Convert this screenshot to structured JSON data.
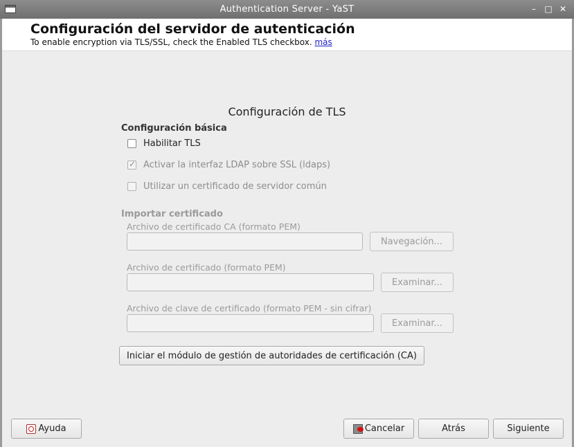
{
  "window": {
    "title": "Authentication Server - YaST",
    "controls": {
      "minimize": "–",
      "maximize": "□",
      "close": "✕"
    }
  },
  "header": {
    "title": "Configuración del servidor de autenticación",
    "help_text": "To enable encryption via TLS/SSL, check the Enabled TLS checkbox.",
    "help_link": "más"
  },
  "main": {
    "section_title": "Configuración de TLS",
    "basic": {
      "group_label": "Configuración básica",
      "checkboxes": [
        {
          "label": "Habilitar TLS",
          "checked": false,
          "enabled": true
        },
        {
          "label": "Activar la interfaz LDAP sobre SSL (ldaps)",
          "checked": true,
          "enabled": false
        },
        {
          "label": "Utilizar un certificado de servidor común",
          "checked": false,
          "enabled": false
        }
      ]
    },
    "import": {
      "group_label": "Importar certificado",
      "fields": [
        {
          "label": "Archivo de certificado CA (formato PEM)",
          "value": "",
          "button": "Navegación..."
        },
        {
          "label": "Archivo de certificado (formato PEM)",
          "value": "",
          "button": "Examinar..."
        },
        {
          "label": "Archivo de clave de certificado (formato PEM - sin cifrar)",
          "value": "",
          "button": "Examinar..."
        }
      ]
    },
    "ca_button": "Iniciar el módulo de gestión de autoridades de certificación (CA)"
  },
  "footer": {
    "help": "Ayuda",
    "cancel": "Cancelar",
    "back": "Atrás",
    "next": "Siguiente"
  },
  "colors": {
    "titlebar": "#7a7a7a",
    "background": "#ededed",
    "link": "#2020c8"
  }
}
